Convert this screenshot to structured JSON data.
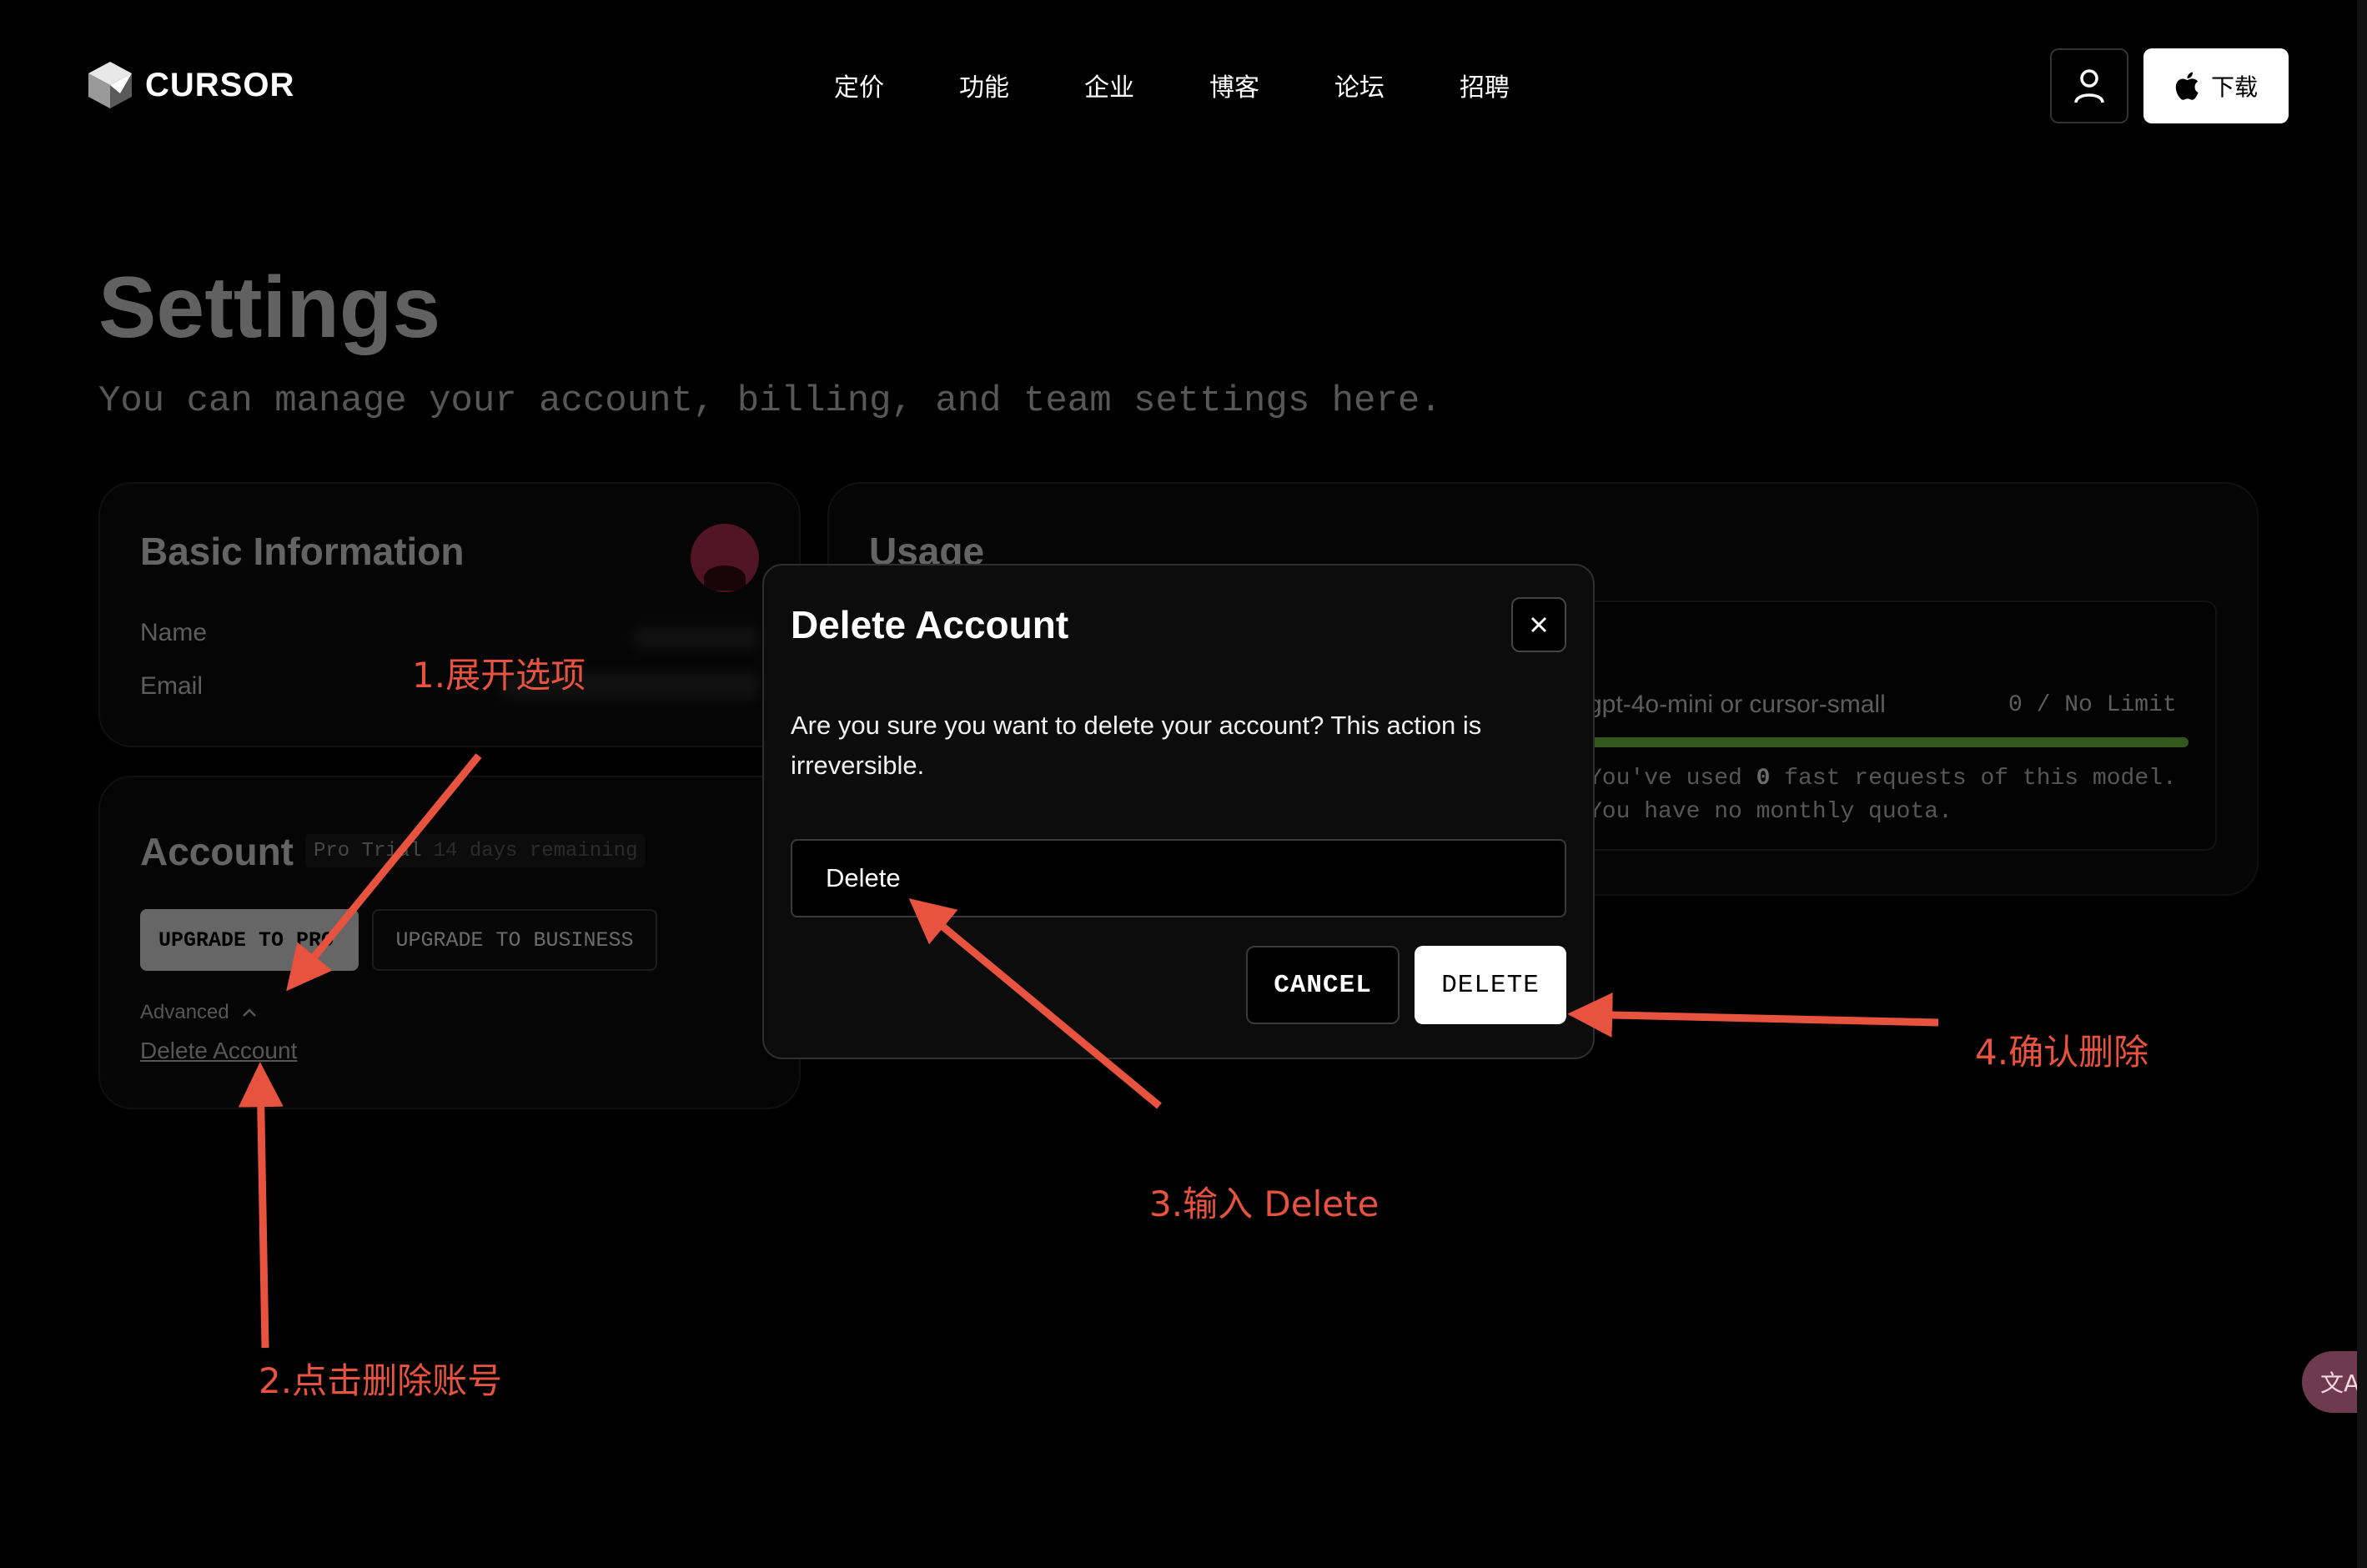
{
  "header": {
    "brand": "CURSOR",
    "nav": [
      "定价",
      "功能",
      "企业",
      "博客",
      "论坛",
      "招聘"
    ],
    "download_label": "下载"
  },
  "settings": {
    "title": "Settings",
    "subtitle": "You can manage your account, billing, and team settings here."
  },
  "basic_info": {
    "title": "Basic Information",
    "name_label": "Name",
    "email_label": "Email"
  },
  "account": {
    "title": "Account",
    "plan_badge": "Pro Trial",
    "plan_remaining": "14 days remaining",
    "upgrade_pro_label": "UPGRADE TO PRO",
    "upgrade_business_label": "UPGRADE TO BUSINESS",
    "advanced_label": "Advanced",
    "delete_link_label": "Delete Account"
  },
  "usage": {
    "title": "Usage",
    "model_label": "gpt-4o-mini or cursor-small",
    "limit_text": "0 / No Limit",
    "note_line1_prefix": "You've used ",
    "note_line1_count": "0",
    "note_line1_suffix": " fast requests of this model.",
    "note_line2": "You have no monthly quota."
  },
  "modal": {
    "title": "Delete Account",
    "message": "Are you sure you want to delete your account? This action is irreversible.",
    "input_value": "Delete",
    "cancel_label": "CANCEL",
    "delete_label": "DELETE"
  },
  "annotations": {
    "step1": "1.展开选项",
    "step2": "2.点击删除账号",
    "step3": "3.输入 Delete",
    "step4": "4.确认删除",
    "color": "#e8533f"
  },
  "translate_fab_label": "文A",
  "colors": {
    "background": "#000000",
    "usage_bar": "#7bd046",
    "annotation": "#e8533f"
  }
}
